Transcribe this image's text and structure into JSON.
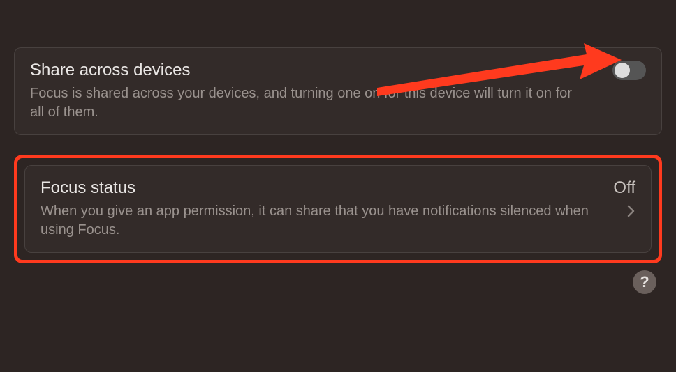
{
  "share": {
    "title": "Share across devices",
    "description": "Focus is shared across your devices, and turning one on for this device will turn it on for all of them.",
    "toggle_on": false
  },
  "focus_status": {
    "title": "Focus status",
    "description": "When you give an app permission, it can share that you have notifications silenced when using Focus.",
    "value": "Off"
  },
  "help_label": "?",
  "annotations": {
    "arrow_points_to": "share-toggle",
    "highlight_box": "focus-status-row"
  }
}
